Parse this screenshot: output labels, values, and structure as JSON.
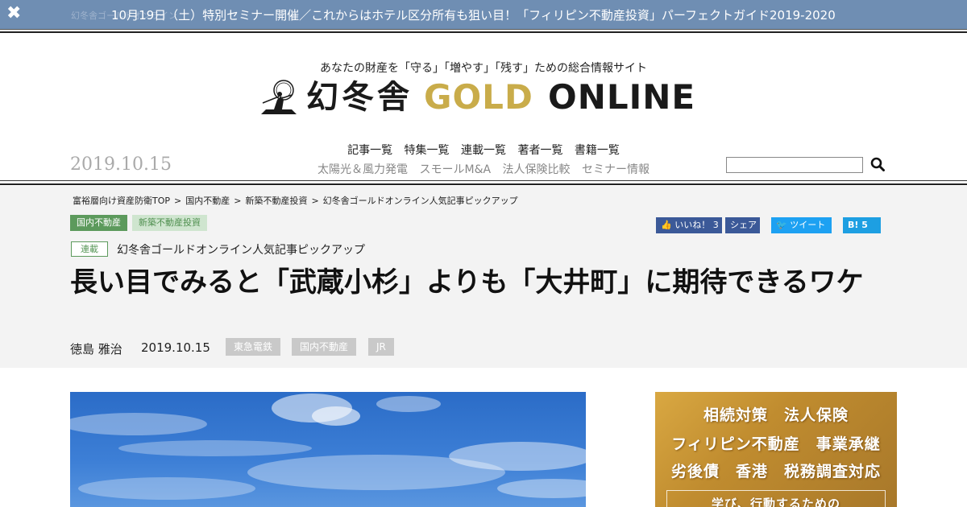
{
  "banner": {
    "ghost_text": "幻冬舎ゴールドオンライン",
    "text": "10月19日（土）特別セミナー開催／これからはホテル区分所有も狙い目！「フィリピン不動産投資」パーフェクトガイド2019-2020",
    "close_glyph": "✖"
  },
  "header": {
    "tagline": "あなたの財産を「守る」「増やす」「残す」ための総合情報サイト",
    "logo_kanji": "幻冬舎",
    "logo_gold": "GOLD",
    "logo_online": "ONLINE",
    "date": "2019.10.15"
  },
  "nav": {
    "main": [
      "記事一覧",
      "特集一覧",
      "連載一覧",
      "著者一覧",
      "書籍一覧"
    ],
    "sub": [
      "太陽光＆風力発電",
      "スモールM&A",
      "法人保険比較",
      "セミナー情報"
    ]
  },
  "search": {
    "placeholder": ""
  },
  "breadcrumb": [
    "富裕層向け資産防衛TOP",
    "国内不動産",
    "新築不動産投資",
    "幻冬舎ゴールドオンライン人気記事ピックアップ"
  ],
  "categories": [
    "国内不動産",
    "新築不動産投資"
  ],
  "share": {
    "like_label": "いいね！",
    "like_count": "3",
    "share_label": "シェア",
    "tweet_label": "ツイート",
    "hatena_label": "B!",
    "hatena_count": "5"
  },
  "article": {
    "series_tag": "連載",
    "series_name": "幻冬舎ゴールドオンライン人気記事ピックアップ",
    "title": "長い目でみると「武蔵小杉」よりも「大井町」に期待できるワケ",
    "author": "徳島 雅治",
    "date": "2019.10.15",
    "keywords": [
      "東急電鉄",
      "国内不動産",
      "JR"
    ]
  },
  "ad": {
    "line1": "相続対策　法人保険",
    "line2": "フィリピン不動産　事業承継",
    "line3": "劣後債　香港　税務調査対応",
    "line4": "学び、行動するための"
  },
  "colors": {
    "banner_bg": "#6f8eb3",
    "gold": "#c9ac4a",
    "category_green": "#5c9a5c",
    "facebook": "#3b5998",
    "twitter": "#1da1f2"
  }
}
